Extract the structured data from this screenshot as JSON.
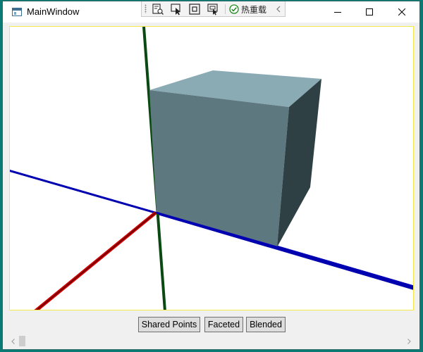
{
  "window": {
    "title": "MainWindow",
    "controls": {
      "minimize": "minimize-icon",
      "maximize": "maximize-icon",
      "close": "close-icon"
    }
  },
  "devtools": {
    "icons": [
      "live-visual-tree-icon",
      "select-element-icon",
      "display-layout-adorners-icon",
      "track-focus-icon"
    ],
    "hot_reload_label": "热重载",
    "hot_reload_status": "ok",
    "collapse_icon": "chevron-left-icon"
  },
  "scene": {
    "axes": [
      {
        "name": "x-axis",
        "color": "#d00000"
      },
      {
        "name": "y-axis",
        "color": "#0a4a12"
      },
      {
        "name": "z-axis",
        "color": "#0000b0"
      }
    ],
    "cube": {
      "top_color": "#8aaab4",
      "front_color": "#5e7880",
      "side_color": "#2e4044"
    }
  },
  "buttons": {
    "shared_points": "Shared Points",
    "faceted": "Faceted",
    "blended": "Blended"
  },
  "colors": {
    "desktop": "#0b7a75",
    "viewport_border": "#f2ea4a"
  }
}
